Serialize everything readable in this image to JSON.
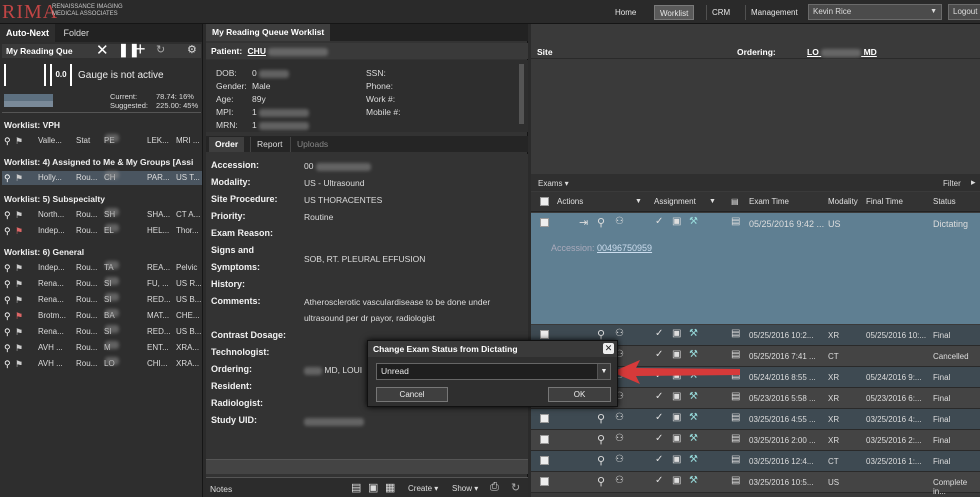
{
  "logo": {
    "mark": "RIMA",
    "line1": "RENAISSANCE IMAGING",
    "line2": "MEDICAL ASSOCIATES"
  },
  "nav": {
    "home": "Home",
    "worklist": "Worklist",
    "crm": "CRM",
    "management": "Management",
    "user": "Kevin Rice",
    "logout": "Logout"
  },
  "left": {
    "tabs": [
      "Auto-Next",
      "Folder"
    ],
    "queue_label": "My Reading Que",
    "gauge_value": "0.0",
    "gauge_status": "Gauge is not active",
    "current_label": "Current:",
    "current_value": "78.74: 16%",
    "suggested_label": "Suggested:",
    "suggested_value": "225.00: 45%",
    "worklists": [
      {
        "title": "Worklist: VPH",
        "rows": [
          {
            "c1": "Valle...",
            "c2": "Stat",
            "c3": "PE",
            "c4": "LEK...",
            "c5": "MRI ..."
          }
        ]
      },
      {
        "title": "Worklist: 4) Assigned to Me & My Groups [Assi",
        "rows": [
          {
            "c1": "Holly...",
            "c2": "Rou...",
            "c3": "CH",
            "c4": "PAR...",
            "c5": "US T..."
          }
        ]
      },
      {
        "title": "Worklist: 5) Subspecialty",
        "rows": [
          {
            "c1": "North...",
            "c2": "Rou...",
            "c3": "SH",
            "c4": "SHA...",
            "c5": "CT A..."
          },
          {
            "c1": "Indep...",
            "c2": "Rou...",
            "c3": "EL",
            "c4": "HEL...",
            "c5": "Thor..."
          }
        ]
      },
      {
        "title": "Worklist: 6) General",
        "rows": [
          {
            "c1": "Indep...",
            "c2": "Rou...",
            "c3": "TA",
            "c4": "REA...",
            "c5": "Pelvic"
          },
          {
            "c1": "Rena...",
            "c2": "Rou...",
            "c3": "SI",
            "c4": "FU, ...",
            "c5": "US R..."
          },
          {
            "c1": "Rena...",
            "c2": "Rou...",
            "c3": "SI",
            "c4": "RED...",
            "c5": "US B..."
          },
          {
            "c1": "Brotm...",
            "c2": "Rou...",
            "c3": "BA",
            "c4": "MAT...",
            "c5": "CHE..."
          },
          {
            "c1": "Rena...",
            "c2": "Rou...",
            "c3": "SI",
            "c4": "RED...",
            "c5": "US B..."
          },
          {
            "c1": "AVH ...",
            "c2": "Rou...",
            "c3": "M",
            "c4": "ENT...",
            "c5": "XRA..."
          },
          {
            "c1": "AVH ...",
            "c2": "Rou...",
            "c3": "LO",
            "c4": "CHI...",
            "c5": "XRA..."
          }
        ]
      }
    ]
  },
  "mid": {
    "tab": "My Reading Queue Worklist",
    "patient_label": "Patient:",
    "patient_name": "CHU",
    "demo_left": [
      {
        "label": "DOB:",
        "value": "0"
      },
      {
        "label": "Gender:",
        "value": "Male"
      },
      {
        "label": "Age:",
        "value": "89y"
      },
      {
        "label": "MPI:",
        "value": "1"
      },
      {
        "label": "MRN:",
        "value": "1"
      }
    ],
    "demo_right": [
      "SSN:",
      "Phone:",
      "Work #:",
      "Mobile #:"
    ],
    "tabs": [
      "Order",
      "Report",
      "Uploads"
    ],
    "order": {
      "accession_label": "Accession:",
      "accession_value": "00",
      "modality_label": "Modality:",
      "modality_value": "US - Ultrasound",
      "site_label": "Site Procedure:",
      "site_value": "US THORACENTES",
      "priority_label": "Priority:",
      "priority_value": "Routine",
      "reason_label": "Exam Reason:",
      "signs_label1": "Signs and",
      "signs_label2": "Symptoms:",
      "signs_value": "SOB, RT. PLEURAL EFFUSION",
      "history_label": "History:",
      "comments_label": "Comments:",
      "comments_line1": "Atherosclerotic vasculardisease to be done under",
      "comments_line2": "ultrasound per dr payor, radiologist",
      "contrast_label": "Contrast Dosage:",
      "tech_label": "Technologist:",
      "ordering_label": "Ordering:",
      "ordering_value": "MD, LOUI",
      "resident_label": "Resident:",
      "radiologist_label": "Radiologist:",
      "uid_label": "Study UID:"
    },
    "notes": "Notes",
    "create": "Create",
    "show": "Show"
  },
  "right": {
    "site_label": "Site",
    "ordering_label": "Ordering:",
    "ordering_value": "LO",
    "ordering_suffix": "MD",
    "exams_label": "Exams",
    "filter_label": "Filter",
    "columns": [
      "Actions",
      "Assignment",
      "Exam Time",
      "Modality",
      "Final Time",
      "Status"
    ],
    "expanded": {
      "exam_time": "05/25/2016 9:42 ...",
      "modality": "US",
      "status": "Dictating",
      "accession_label": "Accession:",
      "accession_value": "00496750959"
    },
    "rows": [
      {
        "exam_time": "05/25/2016 10:2...",
        "modality": "XR",
        "final_time": "05/25/2016 10:...",
        "status": "Final"
      },
      {
        "exam_time": "05/25/2016 7:41 ...",
        "modality": "CT",
        "final_time": "",
        "status": "Cancelled"
      },
      {
        "exam_time": "05/24/2016 8:55 ...",
        "modality": "XR",
        "final_time": "05/24/2016 9:...",
        "status": "Final"
      },
      {
        "exam_time": "05/23/2016 5:58 ...",
        "modality": "XR",
        "final_time": "05/23/2016 6:...",
        "status": "Final"
      },
      {
        "exam_time": "03/25/2016 4:55 ...",
        "modality": "XR",
        "final_time": "03/25/2016 4:...",
        "status": "Final"
      },
      {
        "exam_time": "03/25/2016 2:00 ...",
        "modality": "XR",
        "final_time": "03/25/2016 2:...",
        "status": "Final"
      },
      {
        "exam_time": "03/25/2016 12:4...",
        "modality": "CT",
        "final_time": "03/25/2016 1:...",
        "status": "Final"
      },
      {
        "exam_time": "03/25/2016 10:5...",
        "modality": "US",
        "final_time": "",
        "status": "Complete in..."
      }
    ]
  },
  "dialog": {
    "title": "Change Exam Status from Dictating",
    "select_value": "Unread",
    "cancel": "Cancel",
    "ok": "OK"
  },
  "colors": {
    "accent_red": "#c24545",
    "selected_row": "#5f7f92",
    "arrow": "#d63a3a"
  }
}
